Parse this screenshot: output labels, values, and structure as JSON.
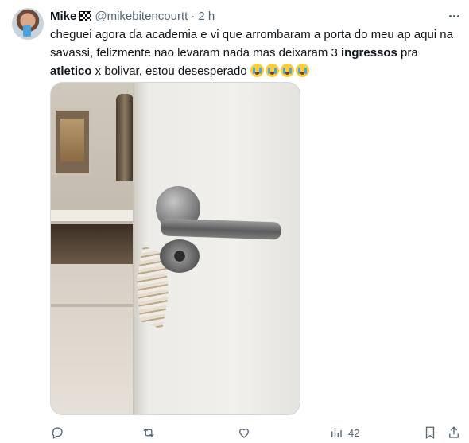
{
  "author": {
    "name": "Mike",
    "handle": "@mikebitencourtt",
    "separator": "·",
    "time": "2 h",
    "badge_icon": "checkered-flag-icon"
  },
  "tweet": {
    "text_part1": "cheguei agora da academia e vi que arrombaram a porta do meu ap aqui na savassi, felizmente nao levaram nada mas deixaram 3 ",
    "bold1": "ingressos",
    "text_part2": " pra ",
    "bold2": "atletico",
    "text_part3": " x bolivar, estou desesperado",
    "emojis": [
      "loudly-crying-face-icon",
      "loudly-crying-face-icon",
      "loudly-crying-face-icon",
      "loudly-crying-face-icon"
    ]
  },
  "media": {
    "type": "photo",
    "subject_icon": "broken-door-photo"
  },
  "actions": {
    "views_count": "42",
    "icons": [
      "reply-icon",
      "retweet-icon",
      "like-icon",
      "views-icon",
      "bookmark-icon",
      "share-icon"
    ]
  },
  "colors": {
    "text_primary": "#0f1419",
    "text_secondary": "#536471",
    "border": "#cfd9de"
  }
}
